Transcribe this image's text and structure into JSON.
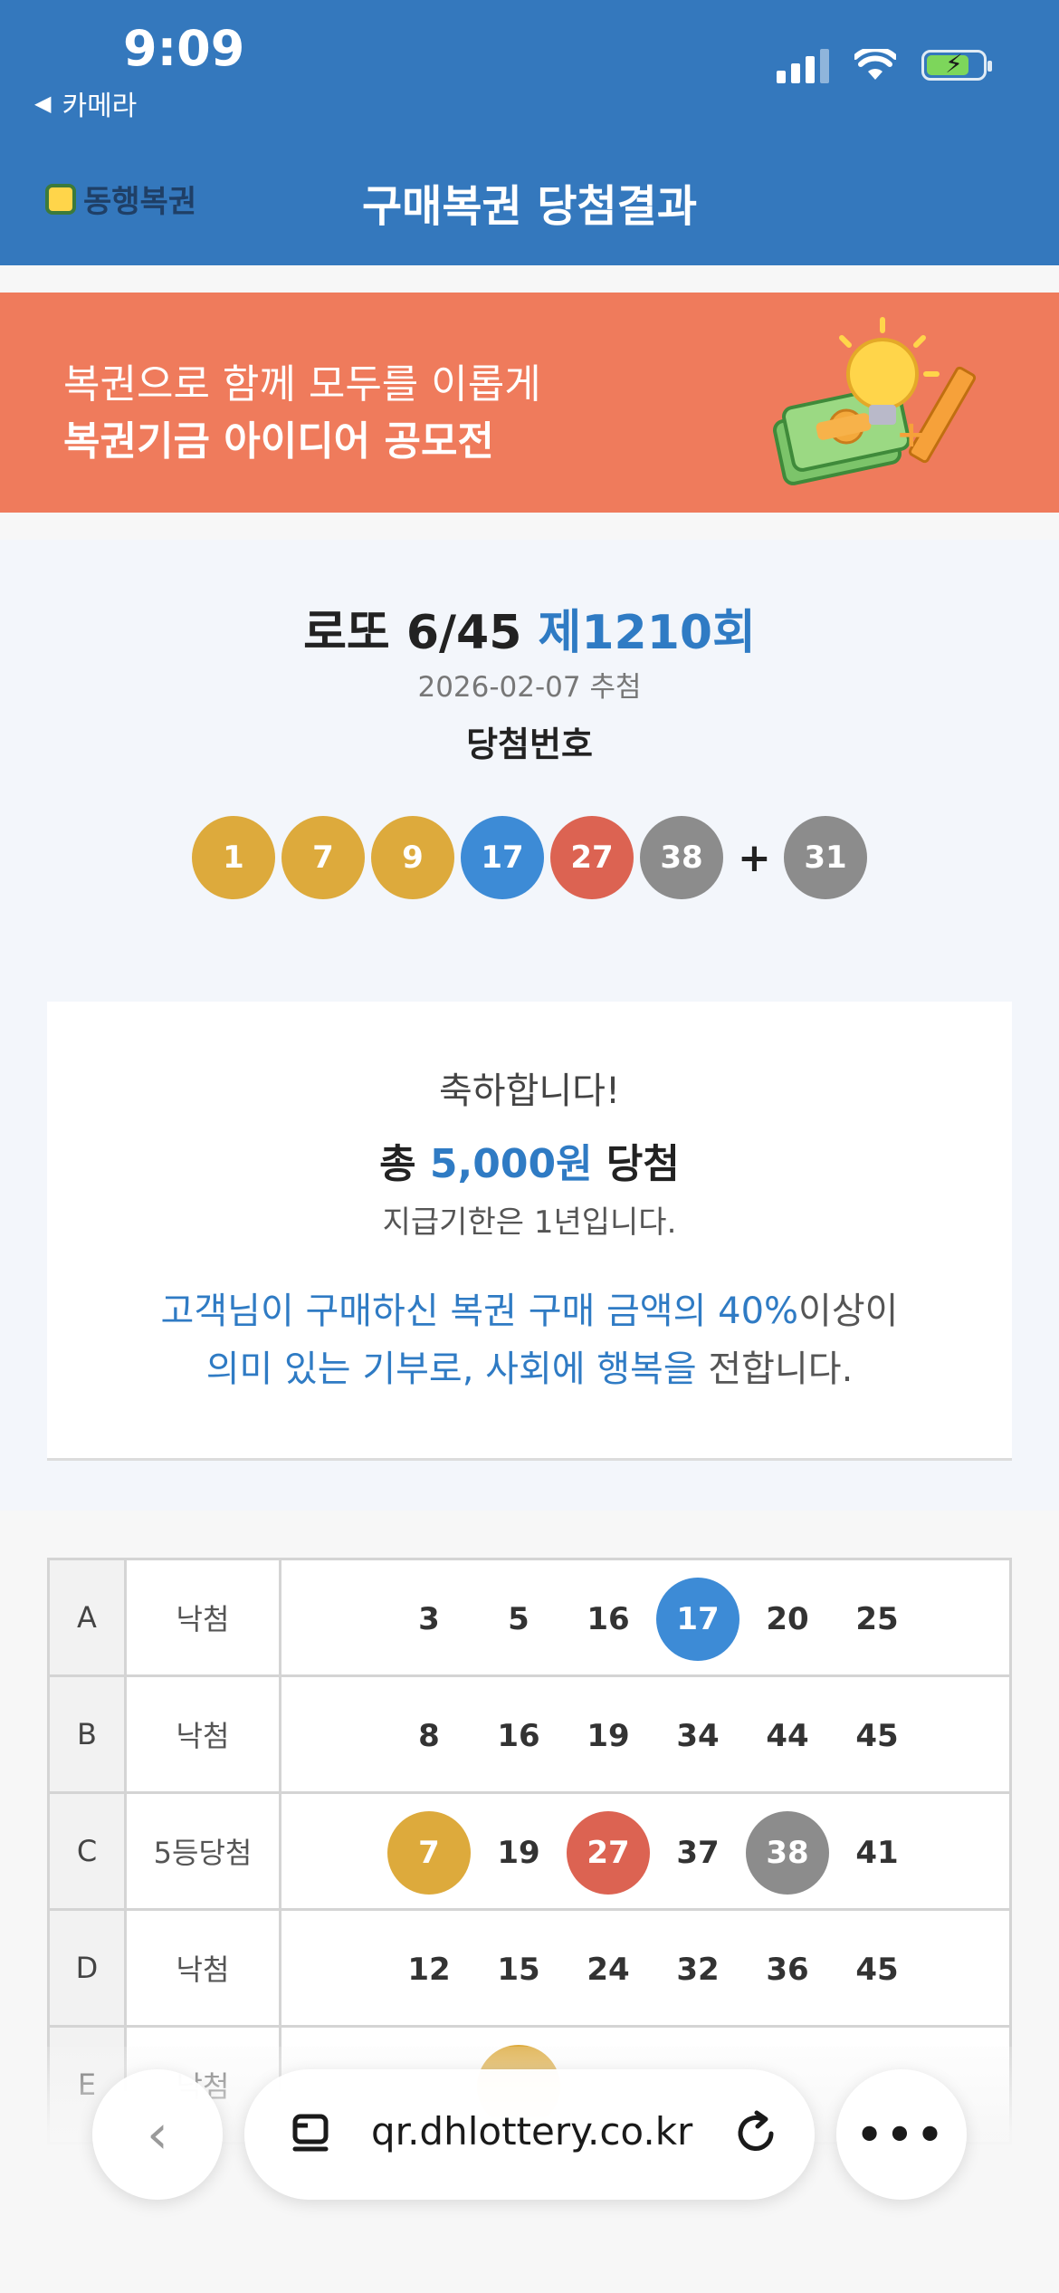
{
  "status_bar": {
    "time": "9:09",
    "back_app_label": "카메라"
  },
  "header": {
    "logo_text": "동행복권",
    "title": "구매복권 당첨결과"
  },
  "banner": {
    "line1": "복권으로 함께 모두를 이롭게",
    "line2": "복권기금 아이디어 공모전"
  },
  "draw": {
    "game_name": "로또 6/45",
    "round_label": "제1210회",
    "date": "2026-02-07 추첨",
    "numbers_label": "당첨번호",
    "winning_numbers": [
      "1",
      "7",
      "9",
      "17",
      "27",
      "38"
    ],
    "plus_sign": "+",
    "bonus_number": "31",
    "ball_colors": {
      "yellow": "#ddaa3c",
      "blue": "#3d8bd6",
      "red": "#dc6352",
      "gray": "#8c8c8c"
    }
  },
  "result_card": {
    "congrats": "축하합니다!",
    "total_prefix": "총",
    "total_amount": "5,000원",
    "total_suffix": "당첨",
    "deadline": "지급기한은 1년입니다.",
    "msg_line1_blue": "고객님이 구매하신 복권 구매 금액의 40%",
    "msg_line1_rest": "이상이",
    "msg_line2_blue": "의미 있는 기부로, 사회에 행복을",
    "msg_line2_rest": " 전합니다."
  },
  "ticket": {
    "rows": [
      {
        "game": "A",
        "result": "낙첨",
        "numbers": [
          "3",
          "5",
          "16",
          "17",
          "20",
          "25"
        ],
        "matched": [
          "",
          "",
          "",
          "blue",
          "",
          ""
        ]
      },
      {
        "game": "B",
        "result": "낙첨",
        "numbers": [
          "8",
          "16",
          "19",
          "34",
          "44",
          "45"
        ],
        "matched": [
          "",
          "",
          "",
          "",
          "",
          ""
        ]
      },
      {
        "game": "C",
        "result": "5등당첨",
        "numbers": [
          "7",
          "19",
          "27",
          "37",
          "38",
          "41"
        ],
        "matched": [
          "yellow",
          "",
          "red",
          "",
          "gray",
          ""
        ]
      },
      {
        "game": "D",
        "result": "낙첨",
        "numbers": [
          "12",
          "15",
          "24",
          "32",
          "36",
          "45"
        ],
        "matched": [
          "",
          "",
          "",
          "",
          "",
          ""
        ]
      },
      {
        "game": "E",
        "result": "낙첨",
        "numbers": [
          "",
          "",
          "",
          "",
          "",
          ""
        ],
        "matched": [
          "",
          "yellow",
          "",
          "",
          "",
          ""
        ]
      }
    ]
  },
  "browser": {
    "url": "qr.dhlottery.co.kr",
    "more_label": "•••"
  }
}
